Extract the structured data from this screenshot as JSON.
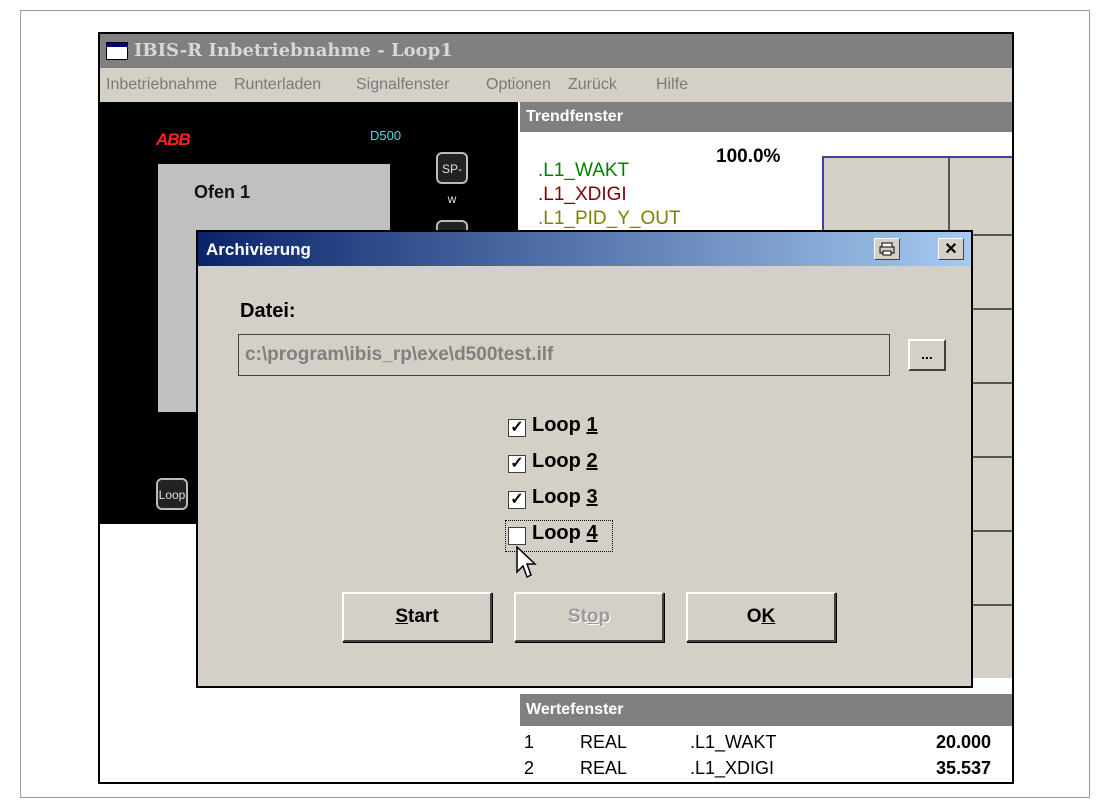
{
  "window": {
    "title": "IBIS-R  Inbetriebnahme - Loop1"
  },
  "menu": [
    "Inbetriebnahme",
    "Runterladen",
    "Signalfenster",
    "Optionen",
    "Zurück",
    "Hilfe"
  ],
  "faceplate": {
    "brand": "ABB",
    "model": "D500",
    "loop_name": "Ofen 1",
    "sp_button": "SP-w",
    "loop_button": "Loop"
  },
  "trend": {
    "header": "Trendfenster",
    "signals": [
      ".L1_WAKT",
      ".L1_XDIGI",
      ".L1_PID_Y_OUT"
    ],
    "signal_colors": [
      "#008000",
      "#800000",
      "#808000"
    ],
    "scale_top": "100.0%"
  },
  "werte": {
    "header": "Wertefenster",
    "rows": [
      {
        "nr": "1",
        "type": "REAL",
        "name": ".L1_WAKT",
        "value": "20.000"
      },
      {
        "nr": "2",
        "type": "REAL",
        "name": ".L1_XDIGI",
        "value": "35.537"
      }
    ]
  },
  "dialog": {
    "title": "Archivierung",
    "file_label": "Datei:",
    "file_value": "c:\\program\\ibis_rp\\exe\\d500test.ilf",
    "browse_label": "...",
    "loops": [
      {
        "prefix": "Loop ",
        "mnemonic": "1",
        "checked": true
      },
      {
        "prefix": "Loop ",
        "mnemonic": "2",
        "checked": true
      },
      {
        "prefix": "Loop ",
        "mnemonic": "3",
        "checked": true
      },
      {
        "prefix": "Loop ",
        "mnemonic": "4",
        "checked": false
      }
    ],
    "buttons": {
      "start": {
        "mnemonic": "S",
        "rest": "tart"
      },
      "stop": {
        "pre": "St",
        "mnemonic": "o",
        "rest": "p"
      },
      "ok": {
        "pre": "O",
        "mnemonic": "K",
        "rest": ""
      }
    }
  }
}
